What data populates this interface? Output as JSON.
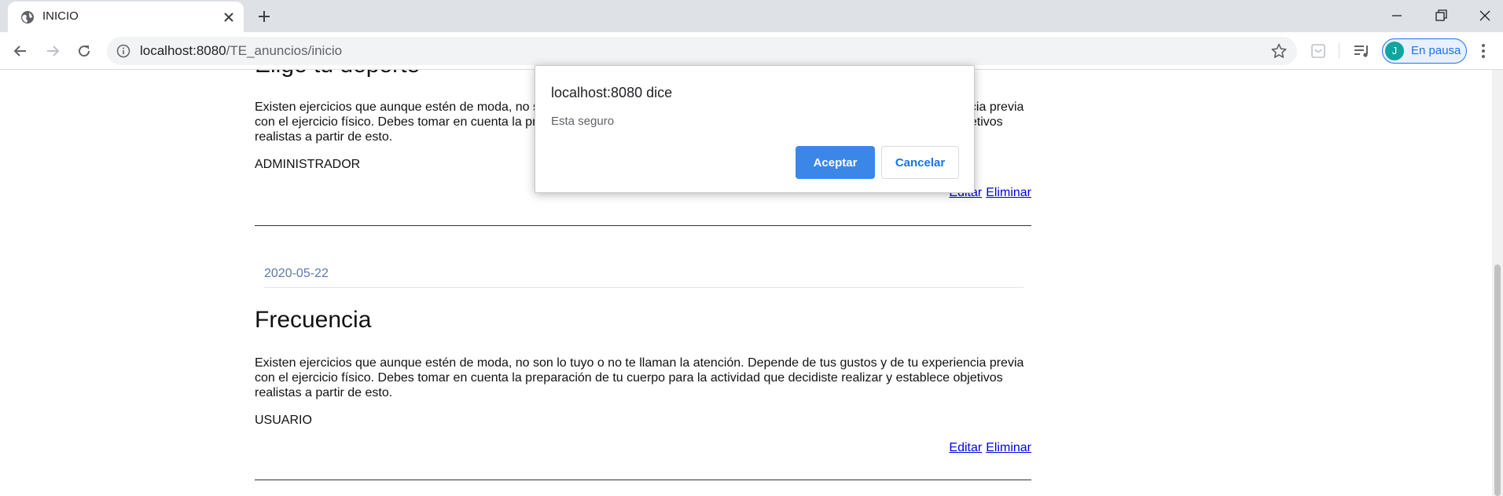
{
  "browser": {
    "tab": {
      "title": "INICIO",
      "favicon": "globe-icon"
    },
    "url": {
      "host": "localhost:8080",
      "path": "/TE_anuncios/inicio"
    },
    "profile": {
      "initial": "J",
      "label": "En pausa",
      "color": "#12a4a0"
    }
  },
  "posts": [
    {
      "title": "Elige tu deporte",
      "body": "Existen ejercicios que aunque estén de moda, no son lo tuyo o no te llaman la atención. Depende de tus gustos y de tu experiencia previa con el ejercicio físico. Debes tomar en cuenta la preparación de tu cuerpo para la actividad que decidiste realizar y establece objetivos realistas a partir de esto.",
      "role": "ADMINISTRADOR",
      "edit_label": "Editar",
      "delete_label": "Eliminar"
    },
    {
      "date": "2020-05-22",
      "title": "Frecuencia",
      "body": "Existen ejercicios que aunque estén de moda, no son lo tuyo o no te llaman la atención. Depende de tus gustos y de tu experiencia previa con el ejercicio físico. Debes tomar en cuenta la preparación de tu cuerpo para la actividad que decidiste realizar y establece objetivos realistas a partir de esto.",
      "role": "USUARIO",
      "edit_label": "Editar",
      "delete_label": "Eliminar"
    }
  ],
  "dialog": {
    "title": "localhost:8080 dice",
    "message": "Esta seguro",
    "ok_label": "Aceptar",
    "cancel_label": "Cancelar",
    "accent": "#3b87e8"
  }
}
